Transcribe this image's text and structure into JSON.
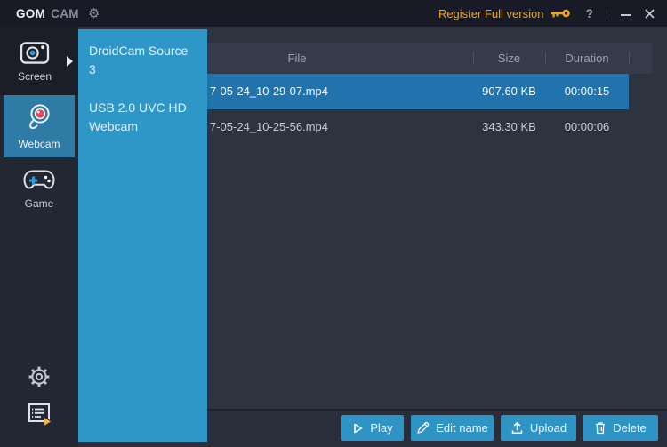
{
  "titlebar": {
    "brand_bold": "GOM",
    "brand_rest": "CAM",
    "register_label": "Register Full version",
    "help_label": "?"
  },
  "sidebar": {
    "items": [
      {
        "id": "screen",
        "label": "Screen",
        "selected": false
      },
      {
        "id": "webcam",
        "label": "Webcam",
        "selected": true
      },
      {
        "id": "game",
        "label": "Game",
        "selected": false
      }
    ]
  },
  "flyout": {
    "items": [
      "DroidCam Source 3",
      "USB 2.0 UVC HD Webcam"
    ]
  },
  "table": {
    "columns": [
      "File",
      "Size",
      "Duration"
    ],
    "rows": [
      {
        "file": "7-05-24_10-29-07.mp4",
        "size": "907.60 KB",
        "duration": "00:00:15",
        "selected": true
      },
      {
        "file": "7-05-24_10-25-56.mp4",
        "size": "343.30 KB",
        "duration": "00:00:06",
        "selected": false
      }
    ]
  },
  "actions": {
    "play": "Play",
    "edit_name": "Edit name",
    "upload": "Upload",
    "delete": "Delete"
  },
  "colors": {
    "accent_blue": "#2f96c8",
    "selected_tile_blue": "#2e7ba6",
    "selected_row_blue": "#2173ae",
    "button_blue": "#2e93c5",
    "register_orange": "#f1a31d",
    "titlebar_bg": "#181b26",
    "sidebar_bg": "#232734",
    "main_bg": "#2e3340",
    "header_bg": "#363b49"
  }
}
